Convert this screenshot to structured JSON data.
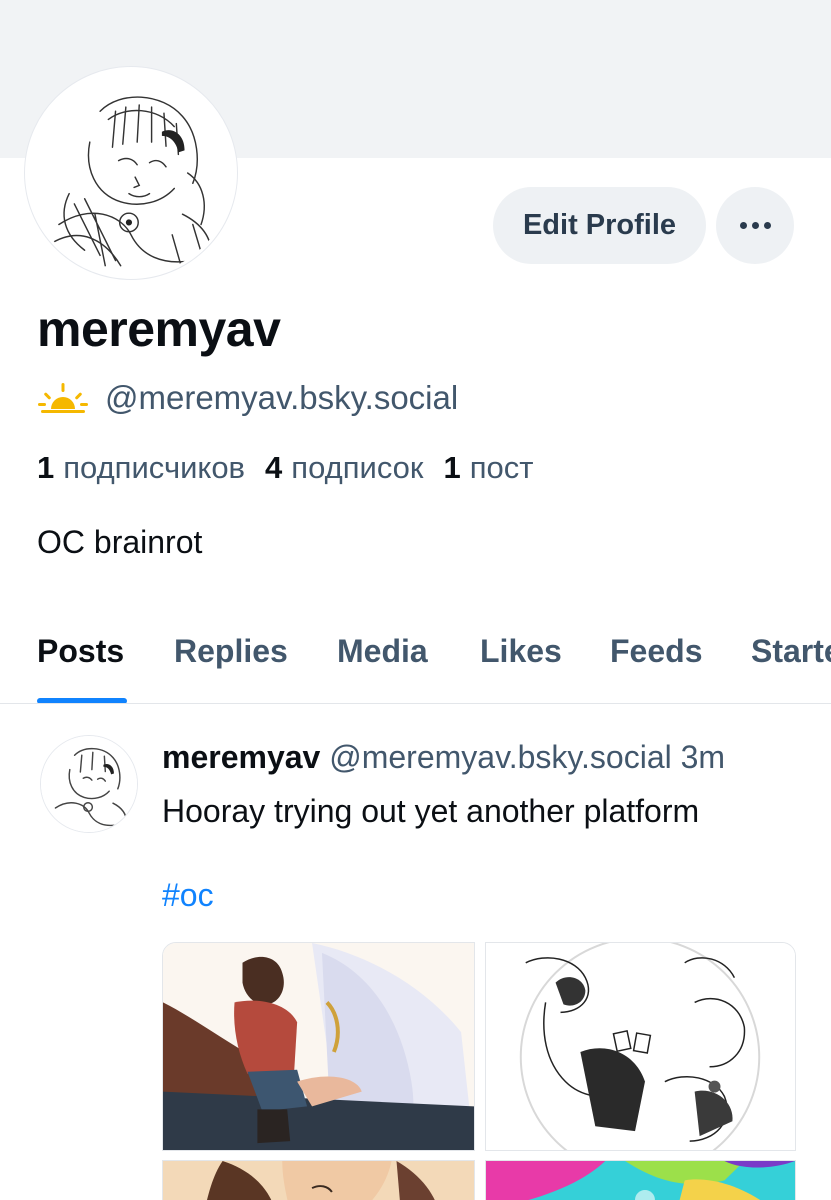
{
  "profile": {
    "display_name": "meremyav",
    "handle": "@meremyav.bsky.social",
    "bio": "OC brainrot",
    "edit_profile_label": "Edit Profile",
    "more_options_icon": "more-dots-icon",
    "handle_icon": "sunrise-icon",
    "handle_icon_color": "#f5b800"
  },
  "stats": {
    "followers_count": "1",
    "followers_label": "подписчиков",
    "following_count": "4",
    "following_label": "подписок",
    "posts_count": "1",
    "posts_label": "пост"
  },
  "tabs": [
    {
      "label": "Posts",
      "active": true
    },
    {
      "label": "Replies",
      "active": false
    },
    {
      "label": "Media",
      "active": false
    },
    {
      "label": "Likes",
      "active": false
    },
    {
      "label": "Feeds",
      "active": false
    },
    {
      "label": "Starter",
      "active": false
    }
  ],
  "post": {
    "author_name": "meremyav",
    "author_handle": "@meremyav.bsky.social",
    "time": "3m",
    "text": "Hooray trying out yet another platform",
    "hashtag": "#oc"
  },
  "colors": {
    "accent": "#1083fe",
    "muted_text": "#42576c",
    "banner": "#f1f3f5",
    "button_bg": "#eef1f4"
  }
}
